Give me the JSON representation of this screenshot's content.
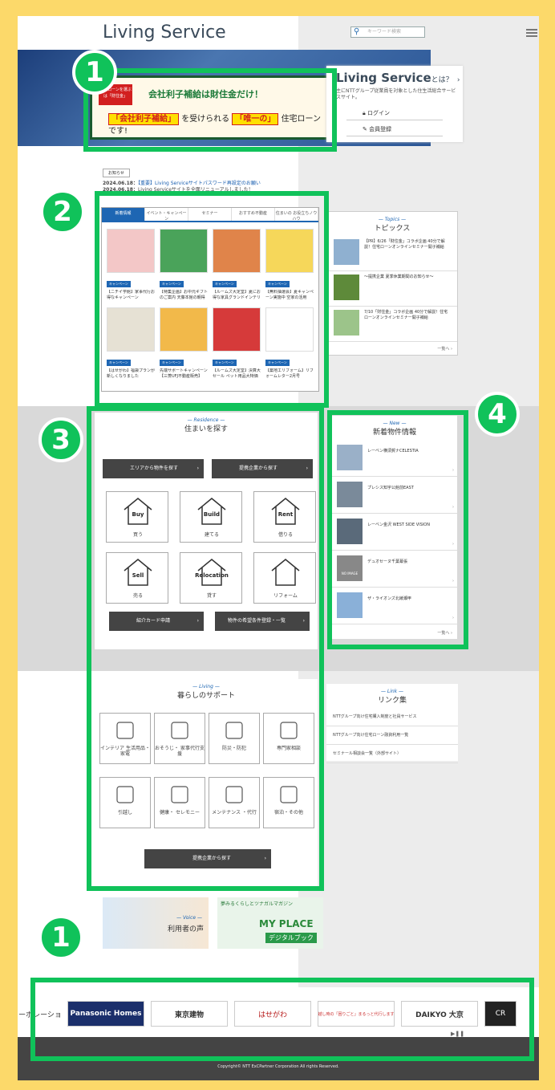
{
  "header": {
    "logo": "Living Service",
    "search_placeholder": "キーワード検索"
  },
  "hero": {
    "banner_tag": "住宅ローンを選ぶは「財住金」",
    "banner_title": "会社利子補給は財住金だけ！",
    "banner_pre": "「会社利子補給」",
    "banner_mid": "を受けられる",
    "banner_only": "「唯一の」",
    "banner_post": "住宅ローンです!"
  },
  "ls_box": {
    "title": "Living Service",
    "title_suffix": "とは？",
    "desc": "主にNTTグループ従業員を対象とした住生活総合サービスサイト。",
    "login": "ログイン",
    "register": "会員登録"
  },
  "news": {
    "label": "お知らせ",
    "items": [
      {
        "date": "2024.06.18：",
        "text": "【重要】Living Serviceサイトパスワード再設定のお願い"
      },
      {
        "date": "2024.06.18：",
        "text": "Living Serviceサイトを全面リニューアルしました！"
      }
    ]
  },
  "tabs": [
    "新着情報",
    "イベント・キャンペーン",
    "セミナー",
    "おすすめ不動産",
    "住まいの お役立ちノウハウ"
  ],
  "cards": [
    {
      "badge": "キャンペーン",
      "text": "【ニチイ学館】家事代行お得なキャンペーン",
      "color": "#f3c7c7"
    },
    {
      "badge": "キャンペーン",
      "text": "【特集企画】お中元ギフトのご案内 天藤本館の朝得",
      "color": "#4aa35a"
    },
    {
      "badge": "キャンペーン",
      "text": "【ルームズ大定堂】夏にお得な家具グランドインテリア",
      "color": "#e0844a"
    },
    {
      "badge": "キャンペーン",
      "text": "【無料抽選会】夏キャンペーン実施中 空家の活用",
      "color": "#f6d75a"
    },
    {
      "badge": "キャンペーン",
      "text": "【はせがわ】福袋プランが新しくなりました",
      "color": "#e6e1d4"
    },
    {
      "badge": "キャンペーン",
      "text": "先端サポートキャンペーン【三菱UFJ不動産販売】",
      "color": "#f2b94a"
    },
    {
      "badge": "キャンペーン",
      "text": "【ルームズ大定堂】決算大セール ペット用品大特価",
      "color": "#d63a3a"
    },
    {
      "badge": "キャンペーン",
      "text": "【築地工リフォーム】リフォームレター2月号",
      "color": "#ffffff"
    }
  ],
  "topics": {
    "en": "— Topics —",
    "jp": "トピックス",
    "items": [
      "【PR】6/26「財住金」コラボ企画 40分で解説！住宅ローンオンラインセミナー開子補給",
      "〜提携企業 夏季休業期間のお知らせ〜",
      "7/10「財住金」コラボ企画 40分で解説！住宅ローンオンラインセミナー開子補給"
    ],
    "more": "一覧へ ›"
  },
  "residence": {
    "en": "— Residence —",
    "jp": "住まいを探す",
    "area_btn": "エリアから物件を探す",
    "partner_btn": "提携企業から探す",
    "houses": [
      {
        "en": "Buy",
        "jp": "買う"
      },
      {
        "en": "Build",
        "jp": "建てる"
      },
      {
        "en": "Rent",
        "jp": "借りる"
      },
      {
        "en": "Sell",
        "jp": "売る"
      },
      {
        "en": "Relocation",
        "jp": "貸す"
      },
      {
        "en": "",
        "jp": "リフォーム"
      }
    ],
    "card_btn": "紹介カード申請",
    "register_btn": "物件の希望条件登録・一覧"
  },
  "new_props": {
    "en": "— New —",
    "jp": "新着物件情報",
    "items": [
      "レーベン横須賀ナCELESTIA",
      "プレシス知宇公館前EAST",
      "レーベン金沢 WEST SIDE VISION",
      "デュオセーヌ千葉幕張",
      "ザ・ライオンズ北綾瀬甲"
    ],
    "noimage": "NO IMAGE",
    "more": "一覧へ ›"
  },
  "living": {
    "en": "— Living —",
    "jp": "暮らしのサポート",
    "items": [
      "インテリア 生活用品・家電",
      "おそうじ・ 家事代行支援",
      "防災・防犯",
      "専門家相談",
      "引越し",
      "健康・ セレモニー",
      "メンテナンス ・代行",
      "宿泊・その他"
    ],
    "partner_btn": "提携企業から探す"
  },
  "links": {
    "en": "— Link —",
    "jp": "リンク集",
    "items": [
      "NTTグループ向け住宅購入制度と社員サービス",
      "NTTグループ向け住宅ローン融資利用一覧",
      "セミナール相談会一覧（外部サイト）"
    ]
  },
  "voice": {
    "en": "— Voice —",
    "jp": "利用者の声"
  },
  "myplace": {
    "top": "夢みるくらしとツナガルマガジン",
    "title": "MY PLACE",
    "sub": "デジタルブック"
  },
  "logos": [
    "コーポレーション",
    "Panasonic Homes",
    "東京建物",
    "はせがわ",
    "引越し時の「困りごと」まるっと代行します！",
    "DAIKYO 大京",
    "CR"
  ],
  "footer": {
    "copyright": "Copyright© NTT ExCPartner Corporation All rights Reserved."
  },
  "markers": [
    "1",
    "2",
    "3",
    "4",
    "1"
  ],
  "colors": {
    "highlight": "#10c25a",
    "accent": "#1e66b3",
    "frame": "#fcd96a"
  }
}
